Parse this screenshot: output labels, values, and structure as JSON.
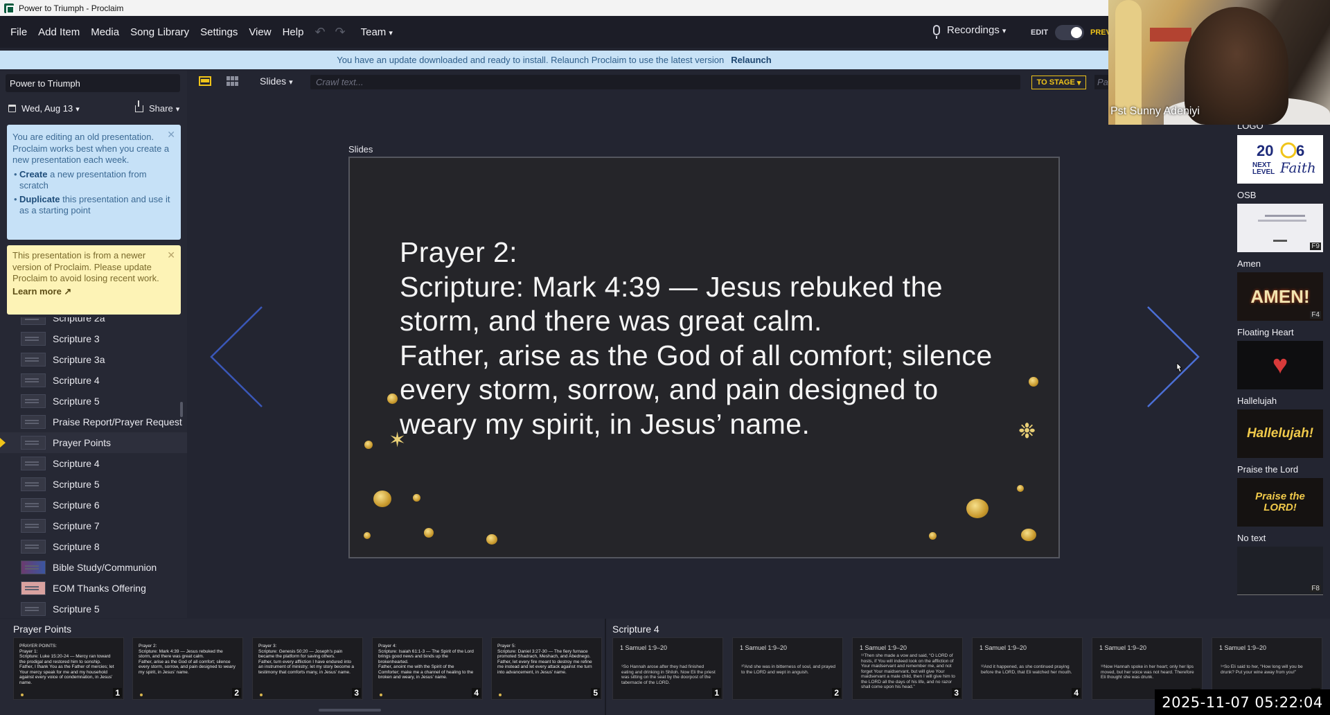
{
  "window": {
    "title": "Power to Triumph - Proclaim"
  },
  "menu": {
    "items": [
      "File",
      "Add Item",
      "Media",
      "Song Library",
      "Settings",
      "View",
      "Help"
    ],
    "team": "Team",
    "recordings": "Recordings",
    "edit": "EDIT",
    "preview": "PREV"
  },
  "banner": {
    "message": "You have an update downloaded and ready to install. Relaunch Proclaim to use the latest version",
    "action": "Relaunch"
  },
  "sidebar": {
    "presentation_title": "Power to Triumph",
    "date": "Wed, Aug 13",
    "share": "Share",
    "note_old": {
      "text": "You are editing an old presentation. Proclaim works best when you create a new presentation each week.",
      "opt1_bold": "Create",
      "opt1_rest": " a new presentation from scratch",
      "opt2_bold": "Duplicate",
      "opt2_rest": " this presentation and use it as a starting point"
    },
    "note_newer": {
      "text": "This presentation is from a newer version of Proclaim. Please update Proclaim to avoid losing recent work.",
      "link": "Learn more"
    },
    "items": [
      "Scripture 2a",
      "Scripture 3",
      "Scripture 3a",
      "Scripture 4",
      "Scripture 5",
      "Praise Report/Prayer Request",
      "Prayer Points",
      "Scripture 4",
      "Scripture 5",
      "Scripture 6",
      "Scripture 7",
      "Scripture 8",
      "Bible Study/Communion",
      "EOM Thanks Offering",
      "Scripture 5"
    ]
  },
  "toolbar": {
    "slides_dropdown": "Slides",
    "crawl_placeholder": "Crawl text...",
    "to_stage": "TO STAGE",
    "right_input_placeholder": "Pa"
  },
  "stage": {
    "label": "Slides",
    "slide_text": "Prayer 2:\nScripture: Mark 4:39 — Jesus rebuked the storm, and there was great calm.\nFather, arise as the God of all comfort; silence every storm, sorrow, and pain designed to weary my spirit, in Jesus’ name."
  },
  "signals": {
    "items": [
      {
        "label": "LOGO",
        "key": "",
        "art": "2026 NEXT LEVEL Faith"
      },
      {
        "label": "OSB",
        "key": "F9",
        "art": ""
      },
      {
        "label": "Amen",
        "key": "F4",
        "art": "AMEN!"
      },
      {
        "label": "Floating Heart",
        "key": "",
        "art": ""
      },
      {
        "label": "Hallelujah",
        "key": "",
        "art": "Hallelujah!"
      },
      {
        "label": "Praise the Lord",
        "key": "",
        "art": "Praise the LORD!"
      },
      {
        "label": "No text",
        "key": "F8",
        "art": ""
      }
    ]
  },
  "webcam": {
    "name": "Pst Sunny Adeniyi"
  },
  "bottom": {
    "group1_label": "Prayer Points",
    "group2_label": "Scripture 4",
    "prayer_slides": [
      {
        "num": "1",
        "text": "PRAYER POINTS:\nPrayer 1:\nScripture: Luke 15:20-24 — Mercy ran toward the prodigal and restored him to sonship.\nFather, I thank You as the Father of mercies; let Your mercy speak for me and my household against every voice of condemnation, in Jesus’ name."
      },
      {
        "num": "2",
        "text": "Prayer 2:\nScripture: Mark 4:39 — Jesus rebuked the storm, and there was great calm.\nFather, arise as the God of all comfort; silence every storm, sorrow, and pain designed to weary my spirit, in Jesus’ name."
      },
      {
        "num": "3",
        "text": "Prayer 3:\nScripture: Genesis 50:20 — Joseph’s pain became the platform for saving others.\nFather, turn every affliction I have endured into an instrument of ministry; let my story become a testimony that comforts many, in Jesus’ name."
      },
      {
        "num": "4",
        "text": "Prayer 4:\nScripture: Isaiah 61:1-3 — The Spirit of the Lord brings good news and binds up the brokenhearted.\nFather, anoint me with the Spirit of the Comforter; make me a channel of healing to the broken and weary, in Jesus’ name."
      },
      {
        "num": "5",
        "text": "Prayer 5:\nScripture: Daniel 3:27-30 — The fiery furnace promoted Shadrach, Meshach, and Abednego.\nFather, let every fire meant to destroy me refine me instead and let every attack against me turn into advancement, in Jesus’ name."
      }
    ],
    "scripture_slides": [
      {
        "num": "1",
        "ref": "1 Samuel 1:9–20",
        "text": "⁹So Hannah arose after they had finished eating and drinking in Shiloh. Now Eli the priest was sitting on the seat by the doorpost of the tabernacle of the LORD."
      },
      {
        "num": "2",
        "ref": "1 Samuel 1:9–20",
        "text": "¹⁰And she was in bitterness of soul, and prayed to the LORD and wept in anguish."
      },
      {
        "num": "3",
        "ref": "1 Samuel 1:9–20",
        "text": "¹¹Then she made a vow and said, “O LORD of hosts, if You will indeed look on the affliction of Your maidservant and remember me, and not forget Your maidservant, but will give Your maidservant a male child, then I will give him to the LORD all the days of his life, and no razor shall come upon his head.”"
      },
      {
        "num": "4",
        "ref": "1 Samuel 1:9–20",
        "text": "¹²And it happened, as she continued praying before the LORD, that Eli watched her mouth."
      },
      {
        "num": "5",
        "ref": "1 Samuel 1:9–20",
        "text": "¹³Now Hannah spoke in her heart; only her lips moved, but her voice was not heard. Therefore Eli thought she was drunk."
      },
      {
        "num": "6",
        "ref": "1 Samuel 1:9–20",
        "text": "¹⁴So Eli said to her, “How long will you be drunk? Put your wine away from you!”"
      }
    ]
  },
  "timestamp": "2025-11-07  05:22:04",
  "colors": {
    "accent": "#f0c419",
    "banner": "#c8e2f6",
    "note_blue": "#c6e1f7",
    "note_yellow": "#fdf3b6",
    "arrow": "#4b6fd6"
  }
}
